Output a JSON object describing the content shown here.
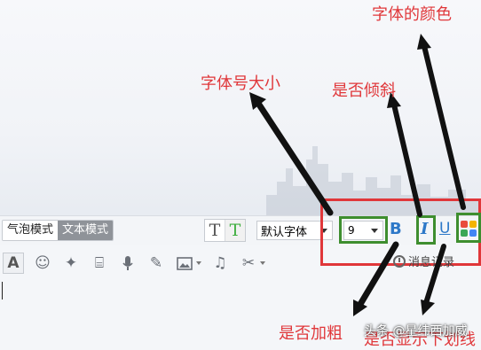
{
  "annotations": {
    "font_color": "字体的颜色",
    "font_size": "字体号大小",
    "italic": "是否倾斜",
    "bold": "是否加粗",
    "underline": "是否显示下划线"
  },
  "toolbar": {
    "mode_bubble": "气泡模式",
    "mode_text": "文本模式",
    "font_family": "默认字体",
    "font_size": "9",
    "bold_label": "B",
    "italic_label": "I",
    "underline_label": "U",
    "history_label": "消息记录"
  },
  "watermark": "头条 @星纬西加威",
  "colors": {
    "annotation_red": "#e0373a",
    "highlight_green": "#3e8e2f",
    "format_blue": "#2d78c8"
  },
  "icons": [
    "font-a-icon",
    "emoji-icon",
    "magic-wand-icon",
    "screenshot-shake-icon",
    "microphone-icon",
    "edit-icon",
    "image-icon",
    "music-icon",
    "scissors-icon",
    "clock-icon",
    "color-palette-icon"
  ]
}
